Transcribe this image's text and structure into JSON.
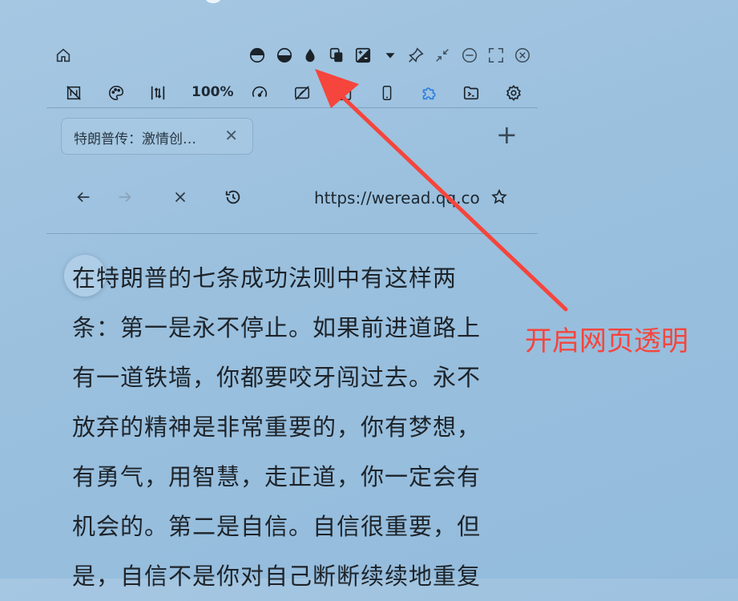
{
  "toolbar_top": {
    "icons": [
      "home-icon",
      "half-dark-top-icon",
      "half-dark-bottom-icon",
      "droplet-icon",
      "layers-icon",
      "exposure-icon",
      "dropdown-icon",
      "pin-icon",
      "shrink-icon",
      "minimize-icon",
      "fullscreen-icon",
      "close-icon"
    ]
  },
  "toolbar_second": {
    "zoom": "100%",
    "icons": [
      "no-image-icon",
      "palette-icon",
      "vertical-resize-icon",
      "speedometer-icon",
      "no-screen-icon",
      "tablet-icon",
      "phone-icon",
      "puzzle-icon",
      "terminal-icon",
      "settings-icon"
    ]
  },
  "tabs": [
    {
      "title": "特朗普传：激情创…",
      "close": "✕"
    }
  ],
  "new_tab": "+",
  "nav": {
    "url": "https://weread.qq.com"
  },
  "content": {
    "lines": [
      "在特朗普的七条成功法则中有这样两",
      "条：第一是永不停止。如果前进道路上",
      "有一道铁墙，你都要咬牙闯过去。永不",
      "放弃的精神是非常重要的，你有梦想，",
      "有勇气，用智慧，走正道，你一定会有",
      "机会的。第二是自信。自信很重要，但",
      "是，自信不是你对自己断断续续地重复"
    ]
  },
  "annotation": {
    "text": "开启网页透明",
    "color": "#f5453c"
  }
}
